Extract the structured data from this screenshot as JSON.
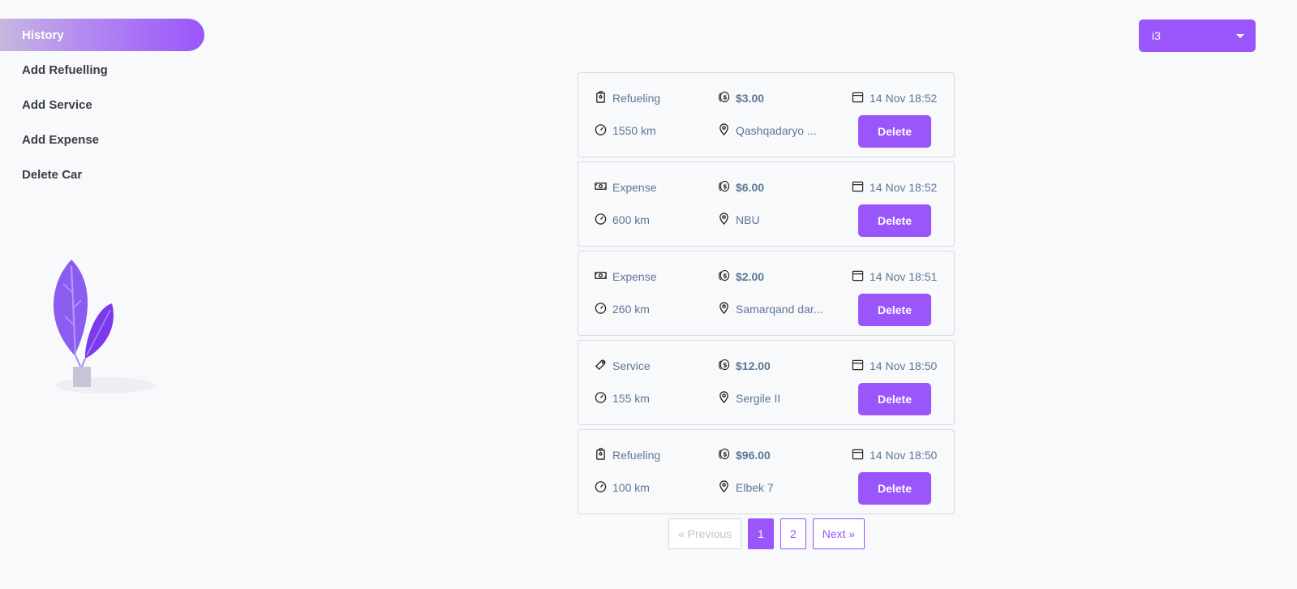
{
  "sidebar": {
    "items": [
      {
        "label": "History",
        "active": true
      },
      {
        "label": "Add Refuelling",
        "active": false
      },
      {
        "label": "Add Service",
        "active": false
      },
      {
        "label": "Add Expense",
        "active": false
      },
      {
        "label": "Delete Car",
        "active": false
      }
    ]
  },
  "car_select": {
    "value": "i3"
  },
  "records": [
    {
      "type": "Refueling",
      "type_icon": "fuel-icon",
      "amount": "$3.00",
      "date": "14 Nov 18:52",
      "odometer": "1550 km",
      "location": "Qashqadaryo ...",
      "delete_label": "Delete"
    },
    {
      "type": "Expense",
      "type_icon": "cash-icon",
      "amount": "$6.00",
      "date": "14 Nov 18:52",
      "odometer": "600 km",
      "location": "NBU",
      "delete_label": "Delete"
    },
    {
      "type": "Expense",
      "type_icon": "cash-icon",
      "amount": "$2.00",
      "date": "14 Nov 18:51",
      "odometer": "260 km",
      "location": "Samarqand dar...",
      "delete_label": "Delete"
    },
    {
      "type": "Service",
      "type_icon": "wrench-icon",
      "amount": "$12.00",
      "date": "14 Nov 18:50",
      "odometer": "155 km",
      "location": "Sergile II",
      "delete_label": "Delete"
    },
    {
      "type": "Refueling",
      "type_icon": "fuel-icon",
      "amount": "$96.00",
      "date": "14 Nov 18:50",
      "odometer": "100 km",
      "location": "Elbek 7",
      "delete_label": "Delete"
    }
  ],
  "pagination": {
    "previous": "« Previous",
    "pages": [
      "1",
      "2"
    ],
    "current": "1",
    "next": "Next »"
  },
  "colors": {
    "accent": "#9a55fb",
    "text_muted": "#5d7795",
    "background": "#f8f9fb"
  }
}
